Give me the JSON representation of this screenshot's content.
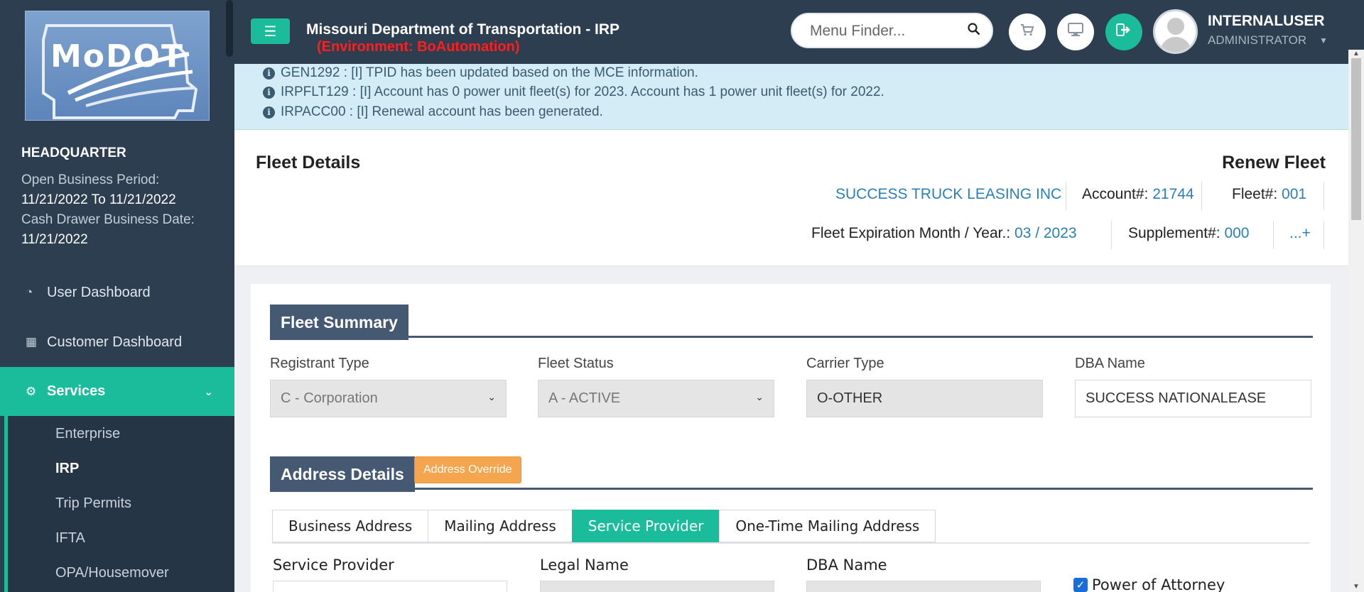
{
  "sidebar": {
    "logo_text": "MoDOT",
    "office": "HEADQUARTER",
    "open_period_label": "Open Business Period:",
    "open_period_value": "11/21/2022 To 11/21/2022",
    "cash_drawer_label": "Cash Drawer Business Date:",
    "cash_drawer_value": "11/21/2022",
    "nav": [
      {
        "label": "User Dashboard",
        "icon": "dashboard-icon"
      },
      {
        "label": "Customer Dashboard",
        "icon": "grid-icon"
      },
      {
        "label": "Services",
        "icon": "cogs-icon"
      }
    ],
    "services_sub": [
      "Enterprise",
      "IRP",
      "Trip Permits",
      "IFTA",
      "OPA/Housemover"
    ]
  },
  "topbar": {
    "title": "Missouri Department of Transportation - IRP",
    "environment": "(Environment: BoAutomation)",
    "menu_finder_placeholder": "Menu Finder...",
    "user_name": "INTERNALUSER",
    "user_role": "ADMINISTRATOR"
  },
  "messages": [
    "GEN1292 : [I] TPID has been updated based on the MCE information.",
    "IRPFLT129 : [I] Account has 0 power unit fleet(s) for 2023. Account has 1 power unit fleet(s) for 2022.",
    "IRPACC00 : [I] Renewal account has been generated."
  ],
  "fleet_header": {
    "title": "Fleet Details",
    "action": "Renew Fleet",
    "company": "SUCCESS TRUCK LEASING INC",
    "account_label": "Account#:",
    "account_value": "21744",
    "fleet_label": "Fleet#:",
    "fleet_value": "001",
    "expiration_label": "Fleet Expiration Month / Year.:",
    "expiration_value": "03 / 2023",
    "supplement_label": "Supplement#:",
    "supplement_value": "000",
    "more": "...+"
  },
  "fleet_summary": {
    "heading": "Fleet Summary",
    "registrant_type_label": "Registrant Type",
    "registrant_type_value": "C - Corporation",
    "fleet_status_label": "Fleet Status",
    "fleet_status_value": "A - ACTIVE",
    "carrier_type_label": "Carrier Type",
    "carrier_type_value": "O-OTHER",
    "dba_name_label": "DBA Name",
    "dba_name_value": "SUCCESS NATIONALEASE"
  },
  "address_details": {
    "heading": "Address Details",
    "override_button": "Address Override",
    "tabs": [
      "Business Address",
      "Mailing Address",
      "Service Provider",
      "One-Time Mailing Address"
    ],
    "active_tab": "Service Provider",
    "service_provider_label": "Service Provider",
    "legal_name_label": "Legal Name",
    "dba_name_label": "DBA Name",
    "power_of_attorney_label": "Power of Attorney",
    "power_of_attorney_checked": true
  },
  "colors": {
    "sidebar_bg": "#2c3e50",
    "accent": "#1abc9c",
    "link_blue": "#2980b9",
    "env_red": "#ff1e1e",
    "section_head": "#455a72",
    "override_orange": "#f5a54e"
  }
}
